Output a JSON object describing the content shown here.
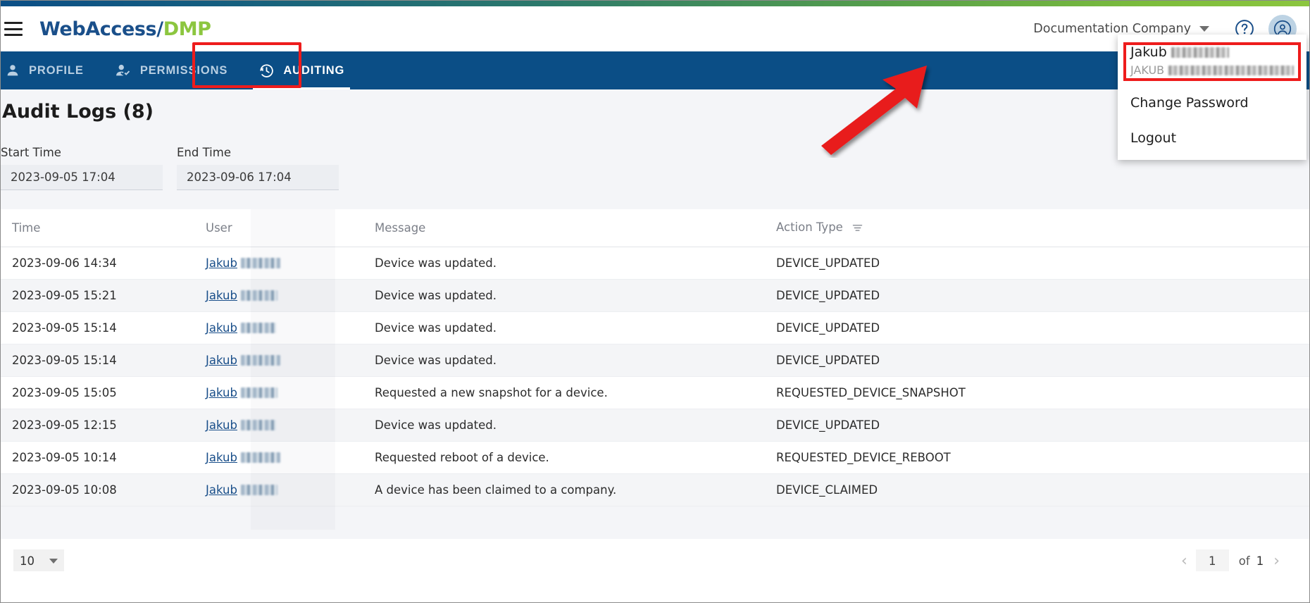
{
  "brand": {
    "part1": "WebAccess/",
    "part2": "DMP"
  },
  "header": {
    "company": "Documentation Company",
    "help_icon": "help-circle-icon",
    "avatar_icon": "account-circle-icon",
    "menu_icon": "hamburger-menu-icon"
  },
  "nav": {
    "tabs": [
      {
        "label": "PROFILE",
        "icon": "person-icon",
        "active": false
      },
      {
        "label": "PERMISSIONS",
        "icon": "person-check-icon",
        "active": false
      },
      {
        "label": "AUDITING",
        "icon": "history-clock-icon",
        "active": true
      }
    ]
  },
  "user_menu": {
    "name_prefix": "Jakub",
    "username_prefix": "JAKUB",
    "items": [
      {
        "label": "Change Password"
      },
      {
        "label": "Logout"
      }
    ]
  },
  "page": {
    "title": "Audit Logs (8)",
    "filters": {
      "start_label": "Start Time",
      "start_value": "2023-09-05 17:04",
      "end_label": "End Time",
      "end_value": "2023-09-06 17:04"
    }
  },
  "table": {
    "columns": [
      "Time",
      "User",
      "Message",
      "Action Type"
    ],
    "action_type_filter_icon": "filter-icon",
    "rows": [
      {
        "time": "2023-09-06 14:34",
        "user": "Jakub",
        "message": "Device was updated.",
        "action_type": "DEVICE_UPDATED"
      },
      {
        "time": "2023-09-05 15:21",
        "user": "Jakub",
        "message": "Device was updated.",
        "action_type": "DEVICE_UPDATED"
      },
      {
        "time": "2023-09-05 15:14",
        "user": "Jakub",
        "message": "Device was updated.",
        "action_type": "DEVICE_UPDATED"
      },
      {
        "time": "2023-09-05 15:14",
        "user": "Jakub",
        "message": "Device was updated.",
        "action_type": "DEVICE_UPDATED"
      },
      {
        "time": "2023-09-05 15:05",
        "user": "Jakub",
        "message": "Requested a new snapshot for a device.",
        "action_type": "REQUESTED_DEVICE_SNAPSHOT"
      },
      {
        "time": "2023-09-05 12:15",
        "user": "Jakub",
        "message": "Device was updated.",
        "action_type": "DEVICE_UPDATED"
      },
      {
        "time": "2023-09-05 10:14",
        "user": "Jakub",
        "message": "Requested reboot of a device.",
        "action_type": "REQUESTED_DEVICE_REBOOT"
      },
      {
        "time": "2023-09-05 10:08",
        "user": "Jakub",
        "message": "A device has been claimed to a company.",
        "action_type": "DEVICE_CLAIMED"
      }
    ]
  },
  "paginator": {
    "page_size": "10",
    "current_page": "1",
    "of_label": "of",
    "total_pages": "1",
    "prev_icon": "chevron-left-icon",
    "next_icon": "chevron-right-icon"
  },
  "colors": {
    "nav_blue": "#0b4e86",
    "brand_blue": "#1a4f8a",
    "brand_green": "#8cc63f",
    "highlight_red": "#ee1c1c",
    "page_bg": "#f4f5f8"
  }
}
